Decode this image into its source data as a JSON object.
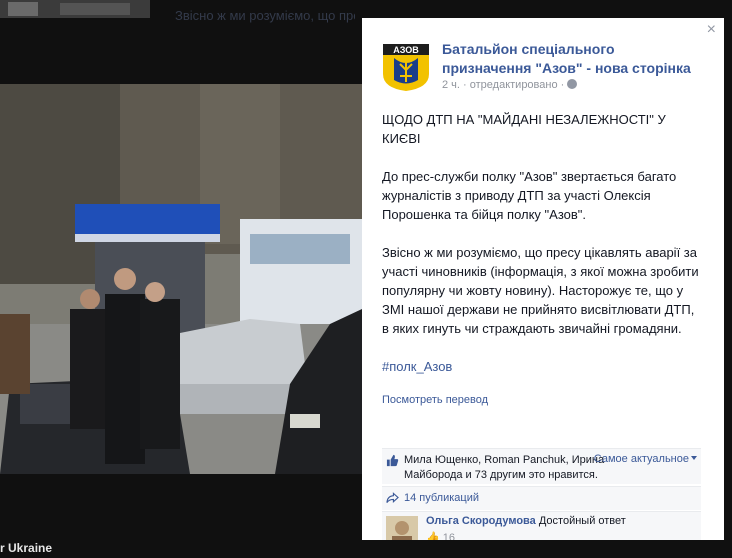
{
  "background": {
    "post_text_snippet": "Звісно ж ми розуміємо, що пресу цікавлять аварії за участі чиновників",
    "caption": "r Ukraine"
  },
  "panel": {
    "close_label": "×",
    "page_name": "Батальйон спеціального призначення \"Азов\" - нова сторінка",
    "logo_text": "АЗОВ",
    "timestamp": "2 ч.",
    "edited_label": "· отредактировано ·",
    "post": {
      "title": "ЩОДО ДТП НА \"МАЙДАНІ НЕЗАЛЕЖНОСТІ\" У КИЄВІ",
      "paragraph1": "До прес-служби полку \"Азов\" звертається багато журналістів з приводу ДТП за участі Олексія Порошенка та бійця полку \"Азов\".",
      "paragraph2": "Звісно ж ми розуміємо, що пресу цікавлять аварії за участі чиновників (інформація, з якої можна зробити популярну чи жовту новину). Насторожує те, що у ЗМІ нашої держави не прийнято висвітлювати ДТП, в яких гинуть чи страждають звичайні громадяни.",
      "hashtag": "#полк_Азов"
    },
    "translate_link": "Посмотреть перевод",
    "likes_text": "Мила Ющенко, Roman Panchuk, Ирина Майборода и 73 другим это нравится.",
    "sort_label": "Самое актуальное",
    "shares_text": "14 публикаций",
    "comment": {
      "author": "Ольга Скородумова",
      "text": "Достойный ответ",
      "likes": "16"
    }
  },
  "colors": {
    "link": "#3b5998",
    "panel_bg": "#ffffff",
    "secondary_text": "#90949c"
  }
}
